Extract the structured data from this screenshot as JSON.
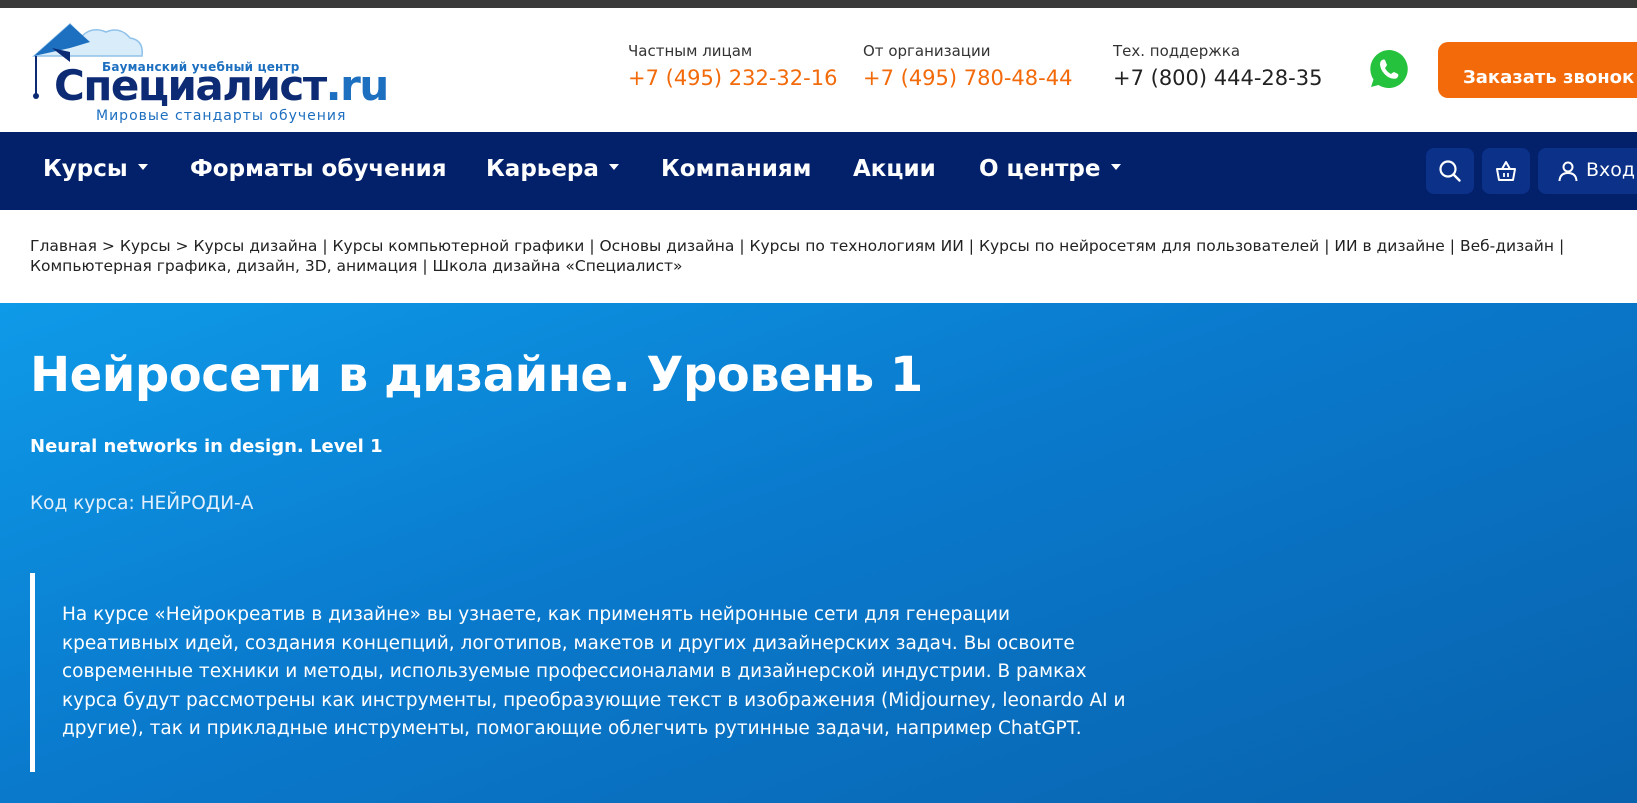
{
  "header": {
    "logo": {
      "tagline_top": "Баумански‌й учебный центр",
      "brand_main": "Специалист",
      "brand_suffix": ".ru",
      "tagline_bottom": "Мировые стандарты обучения"
    },
    "contacts": [
      {
        "label": "Частным лицам",
        "phone": "+7 (495) 232-32-16"
      },
      {
        "label": "От организации",
        "phone": "+7 (495) 780-48-44"
      },
      {
        "label": "Тех. поддержка",
        "phone": "+7 (800) 444-28-35"
      }
    ],
    "whatsapp_icon": "whatsapp-icon",
    "call_button": "Заказать звонок"
  },
  "nav": {
    "items": [
      {
        "label": "Курсы",
        "has_dropdown": true
      },
      {
        "label": "Форматы обучения",
        "has_dropdown": false
      },
      {
        "label": "Карьера",
        "has_dropdown": true
      },
      {
        "label": "Компаниям",
        "has_dropdown": false
      },
      {
        "label": "Акции",
        "has_dropdown": false
      },
      {
        "label": "О центре",
        "has_dropdown": true
      }
    ],
    "search_icon": "search-icon",
    "cart_icon": "basket-icon",
    "login_label": "Вход"
  },
  "breadcrumbs": {
    "items": [
      "Главная",
      "Курсы",
      "Курсы дизайна",
      "Курсы компьютерной графики",
      "Основы дизайна",
      "Курсы по технологиям ИИ",
      "Курсы по нейросетям для пользователей",
      "ИИ в дизайне",
      "Веб-дизайн",
      "Компьютерная графика, дизайн, 3D, анимация",
      "Школа дизайна «Специалист»"
    ],
    "separator_path": ">",
    "separator_list": "|"
  },
  "hero": {
    "title": "Нейросети в дизайне. Уровень 1",
    "subtitle": "Neural networks in design. Level 1",
    "course_code": "Код курса: НЕЙРОДИ-А",
    "description": "На курсе «Нейрокреатив в дизайне» вы узнаете, как применять нейронные сети для генерации креативных идей, создания концепций, логотипов, макетов и других дизайнерских задач. Вы освоите современные техники и методы, используемые профессионалами в дизайнерской индустрии. В рамках курса будут рассмотрены как инструменты, преобразующие текст в изображения (Midjourney, leonardo AI и другие), так и прикладные инструменты, помогающие облегчить рутинные задачи, например ChatGPT."
  },
  "colors": {
    "accent_orange": "#f26a0a",
    "nav_dark_blue": "#03206b",
    "brand_blue": "#0d2a74",
    "hero_blue": "#0a79cc",
    "whatsapp_green": "#25c23e"
  }
}
